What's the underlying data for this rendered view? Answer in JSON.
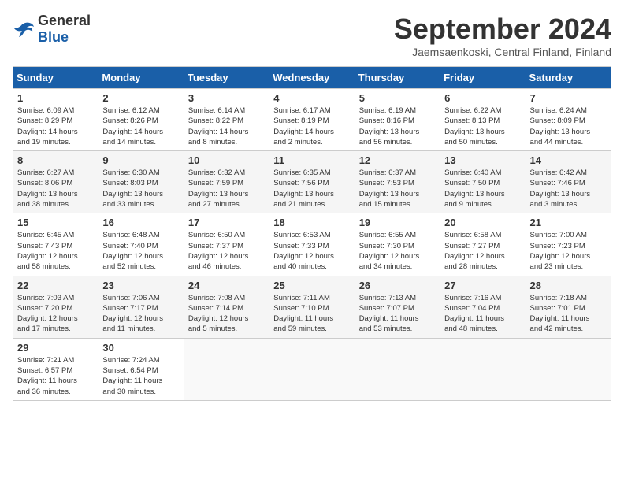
{
  "header": {
    "logo_general": "General",
    "logo_blue": "Blue",
    "month_title": "September 2024",
    "subtitle": "Jaemsaenkoski, Central Finland, Finland"
  },
  "weekdays": [
    "Sunday",
    "Monday",
    "Tuesday",
    "Wednesday",
    "Thursday",
    "Friday",
    "Saturday"
  ],
  "weeks": [
    [
      {
        "day": "1",
        "info": "Sunrise: 6:09 AM\nSunset: 8:29 PM\nDaylight: 14 hours\nand 19 minutes."
      },
      {
        "day": "2",
        "info": "Sunrise: 6:12 AM\nSunset: 8:26 PM\nDaylight: 14 hours\nand 14 minutes."
      },
      {
        "day": "3",
        "info": "Sunrise: 6:14 AM\nSunset: 8:22 PM\nDaylight: 14 hours\nand 8 minutes."
      },
      {
        "day": "4",
        "info": "Sunrise: 6:17 AM\nSunset: 8:19 PM\nDaylight: 14 hours\nand 2 minutes."
      },
      {
        "day": "5",
        "info": "Sunrise: 6:19 AM\nSunset: 8:16 PM\nDaylight: 13 hours\nand 56 minutes."
      },
      {
        "day": "6",
        "info": "Sunrise: 6:22 AM\nSunset: 8:13 PM\nDaylight: 13 hours\nand 50 minutes."
      },
      {
        "day": "7",
        "info": "Sunrise: 6:24 AM\nSunset: 8:09 PM\nDaylight: 13 hours\nand 44 minutes."
      }
    ],
    [
      {
        "day": "8",
        "info": "Sunrise: 6:27 AM\nSunset: 8:06 PM\nDaylight: 13 hours\nand 38 minutes."
      },
      {
        "day": "9",
        "info": "Sunrise: 6:30 AM\nSunset: 8:03 PM\nDaylight: 13 hours\nand 33 minutes."
      },
      {
        "day": "10",
        "info": "Sunrise: 6:32 AM\nSunset: 7:59 PM\nDaylight: 13 hours\nand 27 minutes."
      },
      {
        "day": "11",
        "info": "Sunrise: 6:35 AM\nSunset: 7:56 PM\nDaylight: 13 hours\nand 21 minutes."
      },
      {
        "day": "12",
        "info": "Sunrise: 6:37 AM\nSunset: 7:53 PM\nDaylight: 13 hours\nand 15 minutes."
      },
      {
        "day": "13",
        "info": "Sunrise: 6:40 AM\nSunset: 7:50 PM\nDaylight: 13 hours\nand 9 minutes."
      },
      {
        "day": "14",
        "info": "Sunrise: 6:42 AM\nSunset: 7:46 PM\nDaylight: 13 hours\nand 3 minutes."
      }
    ],
    [
      {
        "day": "15",
        "info": "Sunrise: 6:45 AM\nSunset: 7:43 PM\nDaylight: 12 hours\nand 58 minutes."
      },
      {
        "day": "16",
        "info": "Sunrise: 6:48 AM\nSunset: 7:40 PM\nDaylight: 12 hours\nand 52 minutes."
      },
      {
        "day": "17",
        "info": "Sunrise: 6:50 AM\nSunset: 7:37 PM\nDaylight: 12 hours\nand 46 minutes."
      },
      {
        "day": "18",
        "info": "Sunrise: 6:53 AM\nSunset: 7:33 PM\nDaylight: 12 hours\nand 40 minutes."
      },
      {
        "day": "19",
        "info": "Sunrise: 6:55 AM\nSunset: 7:30 PM\nDaylight: 12 hours\nand 34 minutes."
      },
      {
        "day": "20",
        "info": "Sunrise: 6:58 AM\nSunset: 7:27 PM\nDaylight: 12 hours\nand 28 minutes."
      },
      {
        "day": "21",
        "info": "Sunrise: 7:00 AM\nSunset: 7:23 PM\nDaylight: 12 hours\nand 23 minutes."
      }
    ],
    [
      {
        "day": "22",
        "info": "Sunrise: 7:03 AM\nSunset: 7:20 PM\nDaylight: 12 hours\nand 17 minutes."
      },
      {
        "day": "23",
        "info": "Sunrise: 7:06 AM\nSunset: 7:17 PM\nDaylight: 12 hours\nand 11 minutes."
      },
      {
        "day": "24",
        "info": "Sunrise: 7:08 AM\nSunset: 7:14 PM\nDaylight: 12 hours\nand 5 minutes."
      },
      {
        "day": "25",
        "info": "Sunrise: 7:11 AM\nSunset: 7:10 PM\nDaylight: 11 hours\nand 59 minutes."
      },
      {
        "day": "26",
        "info": "Sunrise: 7:13 AM\nSunset: 7:07 PM\nDaylight: 11 hours\nand 53 minutes."
      },
      {
        "day": "27",
        "info": "Sunrise: 7:16 AM\nSunset: 7:04 PM\nDaylight: 11 hours\nand 48 minutes."
      },
      {
        "day": "28",
        "info": "Sunrise: 7:18 AM\nSunset: 7:01 PM\nDaylight: 11 hours\nand 42 minutes."
      }
    ],
    [
      {
        "day": "29",
        "info": "Sunrise: 7:21 AM\nSunset: 6:57 PM\nDaylight: 11 hours\nand 36 minutes."
      },
      {
        "day": "30",
        "info": "Sunrise: 7:24 AM\nSunset: 6:54 PM\nDaylight: 11 hours\nand 30 minutes."
      },
      {
        "day": "",
        "info": ""
      },
      {
        "day": "",
        "info": ""
      },
      {
        "day": "",
        "info": ""
      },
      {
        "day": "",
        "info": ""
      },
      {
        "day": "",
        "info": ""
      }
    ]
  ]
}
